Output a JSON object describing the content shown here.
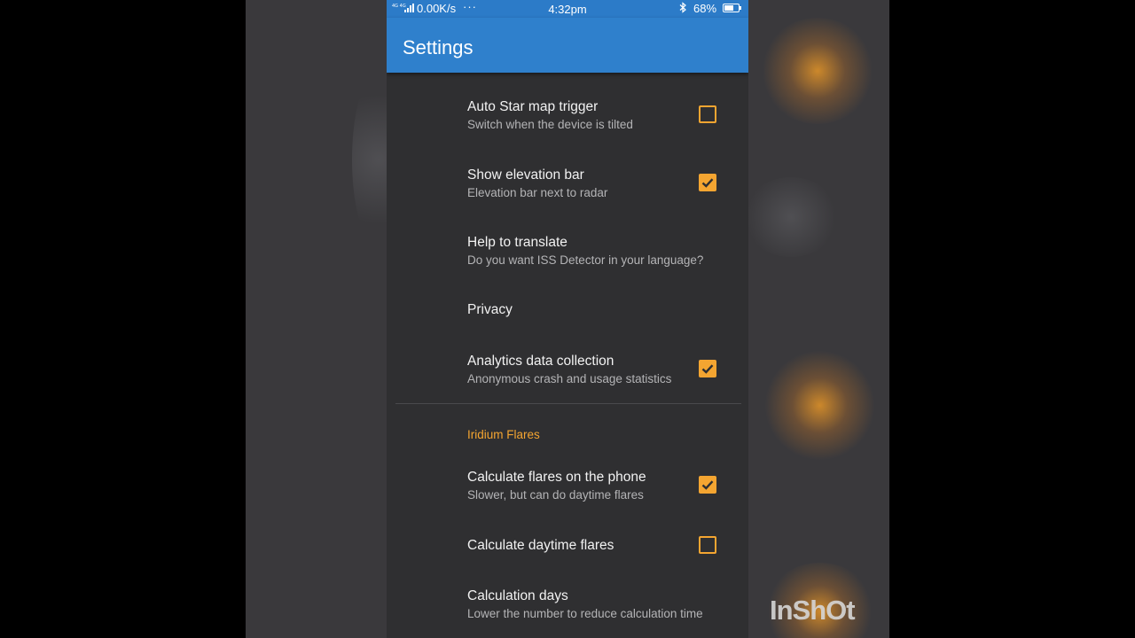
{
  "status_bar": {
    "network_speed": "0.00K/s",
    "more_dots": "···",
    "time": "4:32pm",
    "battery_percent": "68%",
    "battery_level": 0.68
  },
  "app_bar": {
    "title": "Settings"
  },
  "preferences": [
    {
      "title": "Auto Star map trigger",
      "summary": "Switch when the device is tilted",
      "checkbox": false
    },
    {
      "title": "Show elevation bar",
      "summary": "Elevation bar next to radar",
      "checkbox": true
    },
    {
      "title": "Help to translate",
      "summary": "Do you want ISS Detector in your language?"
    },
    {
      "title": "Privacy"
    },
    {
      "title": "Analytics data collection",
      "summary": "Anonymous crash and usage statistics",
      "checkbox": true
    },
    {
      "title": "Calculate flares on the phone",
      "summary": "Slower, but can do daytime flares",
      "checkbox": true
    },
    {
      "title": "Calculate daytime flares",
      "checkbox": false
    },
    {
      "title": "Calculation days",
      "summary": "Lower the number to reduce calculation time"
    }
  ],
  "category_iridium": "Iridium Flares",
  "watermark": "InShOt",
  "colors": {
    "accent": "#f4a531",
    "app_bar": "#2f80cc",
    "background": "#2f2f31"
  }
}
